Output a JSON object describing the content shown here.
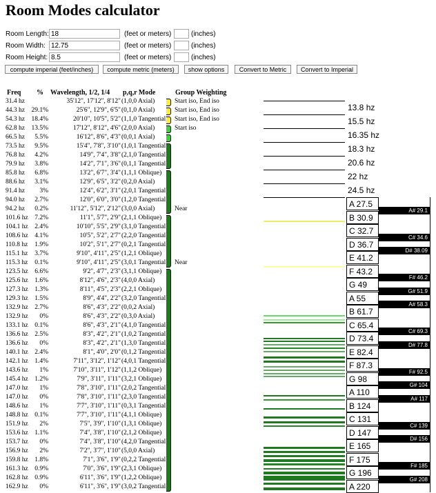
{
  "title": "Room Modes calculator",
  "form": {
    "fields": [
      {
        "label": "Room Length:",
        "value": "18",
        "unit": "(feet or meters)",
        "inch_label": "(inches)"
      },
      {
        "label": "Room Width:",
        "value": "12.75",
        "unit": "(feet or meters)",
        "inch_label": "(inches)"
      },
      {
        "label": "Room Height:",
        "value": "8.5",
        "unit": "(feet or meters)",
        "inch_label": "(inches)"
      }
    ],
    "buttons": [
      "compute imperial (feet/inches)",
      "compute metric (meters)",
      "show options",
      "Convert to Metric",
      "Convert to Imperial"
    ]
  },
  "table": {
    "headers": {
      "freq": "Freq",
      "pct": "%",
      "wave": "Wavelength, 1/2, 1/4",
      "mode": "p,q,r Mode",
      "group": "Group Weighting"
    },
    "rows": [
      {
        "freq": "31.4 hz",
        "pct": "",
        "wave": "35'12\", 17'12\", 8'12\"",
        "mode": "(1,0,0 Axial)"
      },
      {
        "freq": "44.3 hz",
        "pct": "29.1%",
        "wave": "25'6\", 12'9\", 6'5\"",
        "mode": "(0,1,0 Axial)"
      },
      {
        "freq": "54.3 hz",
        "pct": "18.4%",
        "wave": "20'10\", 10'5\", 5'2\"",
        "mode": "(1,1,0 Tangential)"
      },
      {
        "freq": "62.8 hz",
        "pct": "13.5%",
        "wave": "17'12\", 8'12\", 4'6\"",
        "mode": "(2,0,0 Axial)"
      },
      {
        "freq": "66.5 hz",
        "pct": "5.5%",
        "wave": "16'12\", 8'6\", 4'3\"",
        "mode": "(0,0,1 Axial)"
      },
      {
        "freq": "73.5 hz",
        "pct": "9.5%",
        "wave": "15'4\", 7'8\", 3'10\"",
        "mode": "(1,0,1 Tangential)"
      },
      {
        "freq": "76.8 hz",
        "pct": "4.2%",
        "wave": "14'9\", 7'4\", 3'8\"",
        "mode": "(2,1,0 Tangential)"
      },
      {
        "freq": "79.9 hz",
        "pct": "3.8%",
        "wave": "14'2\", 7'1\", 3'6\"",
        "mode": "(0,1,1 Tangential)"
      },
      {
        "freq": "85.8 hz",
        "pct": "6.8%",
        "wave": "13'2\", 6'7\", 3'4\"",
        "mode": "(1,1,1 Oblique)"
      },
      {
        "freq": "88.6 hz",
        "pct": "3.1%",
        "wave": "12'9\", 6'5\", 3'2\"",
        "mode": "(0,2,0 Axial)"
      },
      {
        "freq": "91.4 hz",
        "pct": "3%",
        "wave": "12'4\", 6'2\", 3'1\"",
        "mode": "(2,0,1 Tangential)"
      },
      {
        "freq": "94.0 hz",
        "pct": "2.7%",
        "wave": "12'0\", 6'0\", 3'0\"",
        "mode": "(1,2,0 Tangential)"
      },
      {
        "freq": "94.2 hz",
        "pct": "0.2%",
        "wave": "11'12\", 5'12\", 2'12\"",
        "mode": "(3,0,0 Axial)"
      },
      {
        "freq": "101.6 hz",
        "pct": "7.2%",
        "wave": "11'1\", 5'7\", 2'9\"",
        "mode": "(2,1,1 Oblique)"
      },
      {
        "freq": "104.1 hz",
        "pct": "2.4%",
        "wave": "10'10\", 5'5\", 2'9\"",
        "mode": "(3,1,0 Tangential)"
      },
      {
        "freq": "108.6 hz",
        "pct": "4.1%",
        "wave": "10'5\", 5'2\", 2'7\"",
        "mode": "(2,2,0 Tangential)"
      },
      {
        "freq": "110.8 hz",
        "pct": "1.9%",
        "wave": "10'2\", 5'1\", 2'7\"",
        "mode": "(0,2,1 Tangential)"
      },
      {
        "freq": "115.1 hz",
        "pct": "3.7%",
        "wave": "9'10\", 4'11\", 2'5\"",
        "mode": "(1,2,1 Oblique)"
      },
      {
        "freq": "115.3 hz",
        "pct": "0.1%",
        "wave": "9'10\", 4'11\", 2'5\"",
        "mode": "(3,0,1 Tangential)"
      },
      {
        "freq": "123.5 hz",
        "pct": "6.6%",
        "wave": "9'2\", 4'7\", 2'3\"",
        "mode": "(3,1,1 Oblique)"
      },
      {
        "freq": "125.6 hz",
        "pct": "1.6%",
        "wave": "8'12\", 4'6\", 2'3\"",
        "mode": "(4,0,0 Axial)"
      },
      {
        "freq": "127.3 hz",
        "pct": "1.3%",
        "wave": "8'11\", 4'5\", 2'3\"",
        "mode": "(2,2,1 Oblique)"
      },
      {
        "freq": "129.3 hz",
        "pct": "1.5%",
        "wave": "8'9\", 4'4\", 2'2\"",
        "mode": "(3,2,0 Tangential)"
      },
      {
        "freq": "132.9 hz",
        "pct": "2.7%",
        "wave": "8'6\", 4'3\", 2'2\"",
        "mode": "(0,0,2 Axial)"
      },
      {
        "freq": "132.9 hz",
        "pct": "0%",
        "wave": "8'6\", 4'3\", 2'2\"",
        "mode": "(0,3,0 Axial)"
      },
      {
        "freq": "133.1 hz",
        "pct": "0.1%",
        "wave": "8'6\", 4'3\", 2'1\"",
        "mode": "(4,1,0 Tangential)"
      },
      {
        "freq": "136.6 hz",
        "pct": "2.5%",
        "wave": "8'3\", 4'2\", 2'1\"",
        "mode": "(1,0,2 Tangential)"
      },
      {
        "freq": "136.6 hz",
        "pct": "0%",
        "wave": "8'3\", 4'2\", 2'1\"",
        "mode": "(1,3,0 Tangential)"
      },
      {
        "freq": "140.1 hz",
        "pct": "2.4%",
        "wave": "8'1\", 4'0\", 2'0\"",
        "mode": "(0,1,2 Tangential)"
      },
      {
        "freq": "142.1 hz",
        "pct": "1.4%",
        "wave": "7'11\", 3'12\", 1'12\"",
        "mode": "(4,0,1 Tangential)"
      },
      {
        "freq": "143.6 hz",
        "pct": "1%",
        "wave": "7'10\", 3'11\", 1'12\"",
        "mode": "(1,1,2 Oblique)"
      },
      {
        "freq": "145.4 hz",
        "pct": "1.2%",
        "wave": "7'9\", 3'11\", 1'11\"",
        "mode": "(3,2,1 Oblique)"
      },
      {
        "freq": "147.0 hz",
        "pct": "1%",
        "wave": "7'8\", 3'10\", 1'11\"",
        "mode": "(2,0,2 Tangential)"
      },
      {
        "freq": "147.0 hz",
        "pct": "0%",
        "wave": "7'8\", 3'10\", 1'11\"",
        "mode": "(2,3,0 Tangential)"
      },
      {
        "freq": "148.6 hz",
        "pct": "1%",
        "wave": "7'7\", 3'10\", 1'11\"",
        "mode": "(0,3,1 Tangential)"
      },
      {
        "freq": "148.8 hz",
        "pct": "0.1%",
        "wave": "7'7\", 3'10\", 1'11\"",
        "mode": "(4,1,1 Oblique)"
      },
      {
        "freq": "151.9 hz",
        "pct": "2%",
        "wave": "7'5\", 3'9\", 1'10\"",
        "mode": "(1,3,1 Oblique)"
      },
      {
        "freq": "153.6 hz",
        "pct": "1.1%",
        "wave": "7'4\", 3'8\", 1'10\"",
        "mode": "(2,1,2 Oblique)"
      },
      {
        "freq": "153.7 hz",
        "pct": "0%",
        "wave": "7'4\", 3'8\", 1'10\"",
        "mode": "(4,2,0 Tangential)"
      },
      {
        "freq": "156.9 hz",
        "pct": "2%",
        "wave": "7'2\", 3'7\", 1'10\"",
        "mode": "(5,0,0 Axial)"
      },
      {
        "freq": "159.8 hz",
        "pct": "1.8%",
        "wave": "7'1\", 3'6\", 1'9\"",
        "mode": "(0,2,2 Tangential)"
      },
      {
        "freq": "161.3 hz",
        "pct": "0.9%",
        "wave": "7'0\", 3'6\", 1'9\"",
        "mode": "(2,3,1 Oblique)"
      },
      {
        "freq": "162.8 hz",
        "pct": "0.9%",
        "wave": "6'11\", 3'6\", 1'9\"",
        "mode": "(1,2,2 Oblique)"
      },
      {
        "freq": "162.9 hz",
        "pct": "0%",
        "wave": "6'11\", 3'6\", 1'9\"",
        "mode": "(3,0,2 Tangential)"
      }
    ],
    "group_notes": {
      "iso": [
        "Start iso, End iso",
        "Start iso, End iso",
        "Start iso, End iso",
        "Start iso"
      ],
      "near": [
        "Near",
        "Near"
      ]
    }
  },
  "spectrum": {
    "freq_labels": [
      "13.8 hz",
      "15.5 hz",
      "16.35 hz",
      "18.3 hz",
      "20.6 hz",
      "22 hz",
      "24.5 hz"
    ],
    "white_keys": [
      "A 27.5",
      "B 30.9",
      "C 32.7",
      "D 36.7",
      "E 41.2",
      "F 43.2",
      "G 49",
      "A 55",
      "B 61.7",
      "C 65.4",
      "D 73.4",
      "E 82.4",
      "F 87.3",
      "G 98",
      "A 110",
      "B 124",
      "C 131",
      "D 147",
      "E 165",
      "F 175",
      "G 196",
      "A 220"
    ],
    "black_keys": [
      "A# 29.1",
      "C# 34.6",
      "D# 38.09",
      "F# 46.2",
      "G# 51.9",
      "A# 58.3",
      "C# 69.3",
      "D# 77.8",
      "F# 92.5",
      "G# 104",
      "A# 117",
      "C# 139",
      "D# 156",
      "F# 185",
      "G# 208"
    ]
  }
}
